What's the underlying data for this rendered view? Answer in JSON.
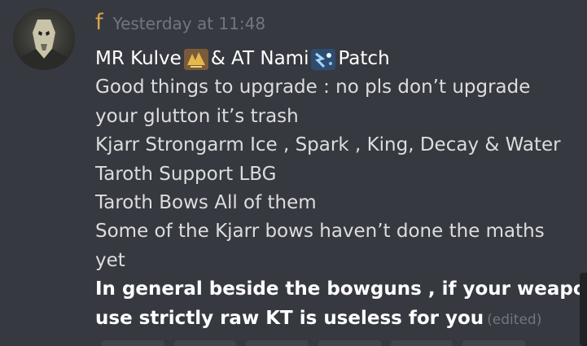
{
  "message": {
    "author": "f",
    "timestamp": "Yesterday at 11:48",
    "avatar_icon": "general-grievous-avatar-icon",
    "first_line": {
      "part1": "MR Kulve",
      "emoji1_icon": "kulve-taroth-emoji-icon",
      "part2": "& AT Nami",
      "emoji2_icon": "namielle-emoji-icon",
      "part3": "Patch"
    },
    "lines": [
      "Good things to upgrade : no pls don’t upgrade",
      "your glutton it’s trash",
      "Kjarr Strongarm Ice , Spark , King, Decay & Water",
      "Taroth Support LBG",
      "Taroth Bows All of them",
      "Some of the Kjarr bows haven’t done the maths",
      "yet"
    ],
    "bold_lines": [
      "In general beside the bowguns , if your weapon",
      "use strictly raw KT is useless for you"
    ],
    "edited_label": "(edited)"
  },
  "colors": {
    "background": "#36393f",
    "username": "#d4a44c",
    "timestamp": "#72767d",
    "text": "#dcddde",
    "bold_text": "#ffffff"
  }
}
